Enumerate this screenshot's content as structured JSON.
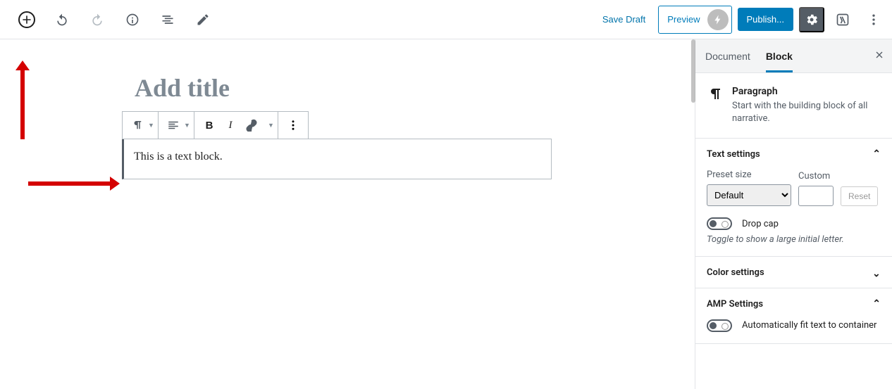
{
  "toolbar": {
    "save_draft": "Save Draft",
    "preview": "Preview",
    "publish": "Publish..."
  },
  "editor": {
    "title_placeholder": "Add title",
    "paragraph_text": "This is a text block.",
    "toolbar_bold": "B",
    "toolbar_italic": "I"
  },
  "sidebar": {
    "tabs": {
      "document": "Document",
      "block": "Block"
    },
    "block_card": {
      "title": "Paragraph",
      "desc": "Start with the building block of all narrative."
    },
    "text_settings": {
      "heading": "Text settings",
      "preset_label": "Preset size",
      "preset_value": "Default",
      "custom_label": "Custom",
      "reset": "Reset",
      "drop_cap_label": "Drop cap",
      "drop_cap_desc": "Toggle to show a large initial letter."
    },
    "color_settings": {
      "heading": "Color settings"
    },
    "amp_settings": {
      "heading": "AMP Settings",
      "fit_text": "Automatically fit text to container"
    }
  }
}
